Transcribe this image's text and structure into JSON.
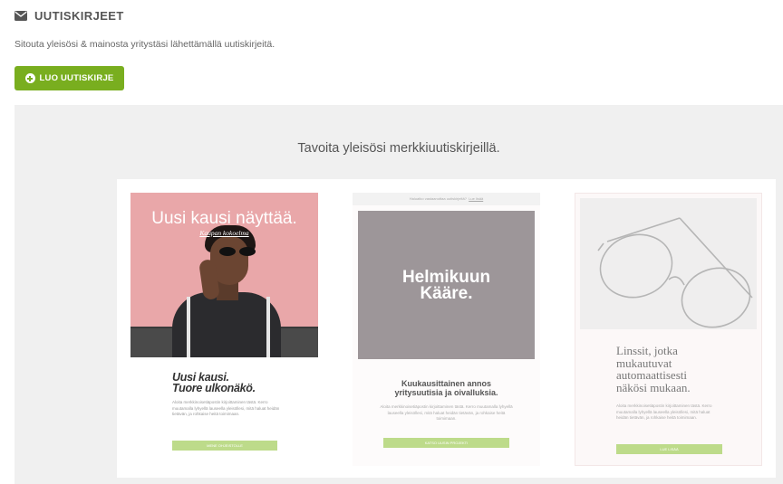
{
  "header": {
    "icon": "envelope-icon",
    "title": "UUTISKIRJEET"
  },
  "subtitle": "Sitouta yleisösi & mainosta yritystäsi lähettämällä uutiskirjeitä.",
  "create_button": {
    "icon": "plus-circle-icon",
    "label": "LUO UUTISKIRJE",
    "color": "#79ae1f"
  },
  "showcase": {
    "title": "Tavoita yleisösi merkkiuutiskirjeillä.",
    "cards": [
      {
        "hero_title": "Uusi kausi näyttää.",
        "hero_link": "Kaupan kokoelma",
        "title_line1": "Uusi kausi.",
        "title_line2": "Tuore ulkonäkö.",
        "text": "Aloita merkkinoisetiäpostin kirjoittaminen tästä. Kerro muutamalla lyhyellä lauseella yleisöllesi, mitä haluat heidän tietävän, ja rohkaise heitä toimimaan.",
        "button": "MENE OHJEISTOLLE"
      },
      {
        "topbar_text": "Haluatko vastaanottaa uutiskirjeitä?",
        "topbar_link": "Lue lisää",
        "hero_title_line1": "Helmikuun",
        "hero_title_line2": "Kääre.",
        "title_line1": "Kuukausittainen annos",
        "title_line2": "yritysuutisia ja oivalluksia.",
        "text": "Aloita merkkinoisetiäpostin kirjoittaminen tästä. Kerro muutamalla lyhyellä lauseella yleisöllesi, mitä haluat heidän tietävän, ja rohkaise heitä toimimaan.",
        "button": "KATSO UUSIN PROJEKTI"
      },
      {
        "title_line1": "Linssit, jotka",
        "title_line2": "mukautuvat",
        "title_line3": "automaattisesti",
        "title_line4": "näkösi mukaan.",
        "text": "Aloita merkkinoisetiäpostin kirjoittaminen tästä. Kerro muutamalla lyhyellä lauseella yleisöllesi, mitä haluat heidän tietävän, ja rohkaise heitä toimimaan.",
        "button": "LUE LISÄÄ"
      }
    ]
  }
}
